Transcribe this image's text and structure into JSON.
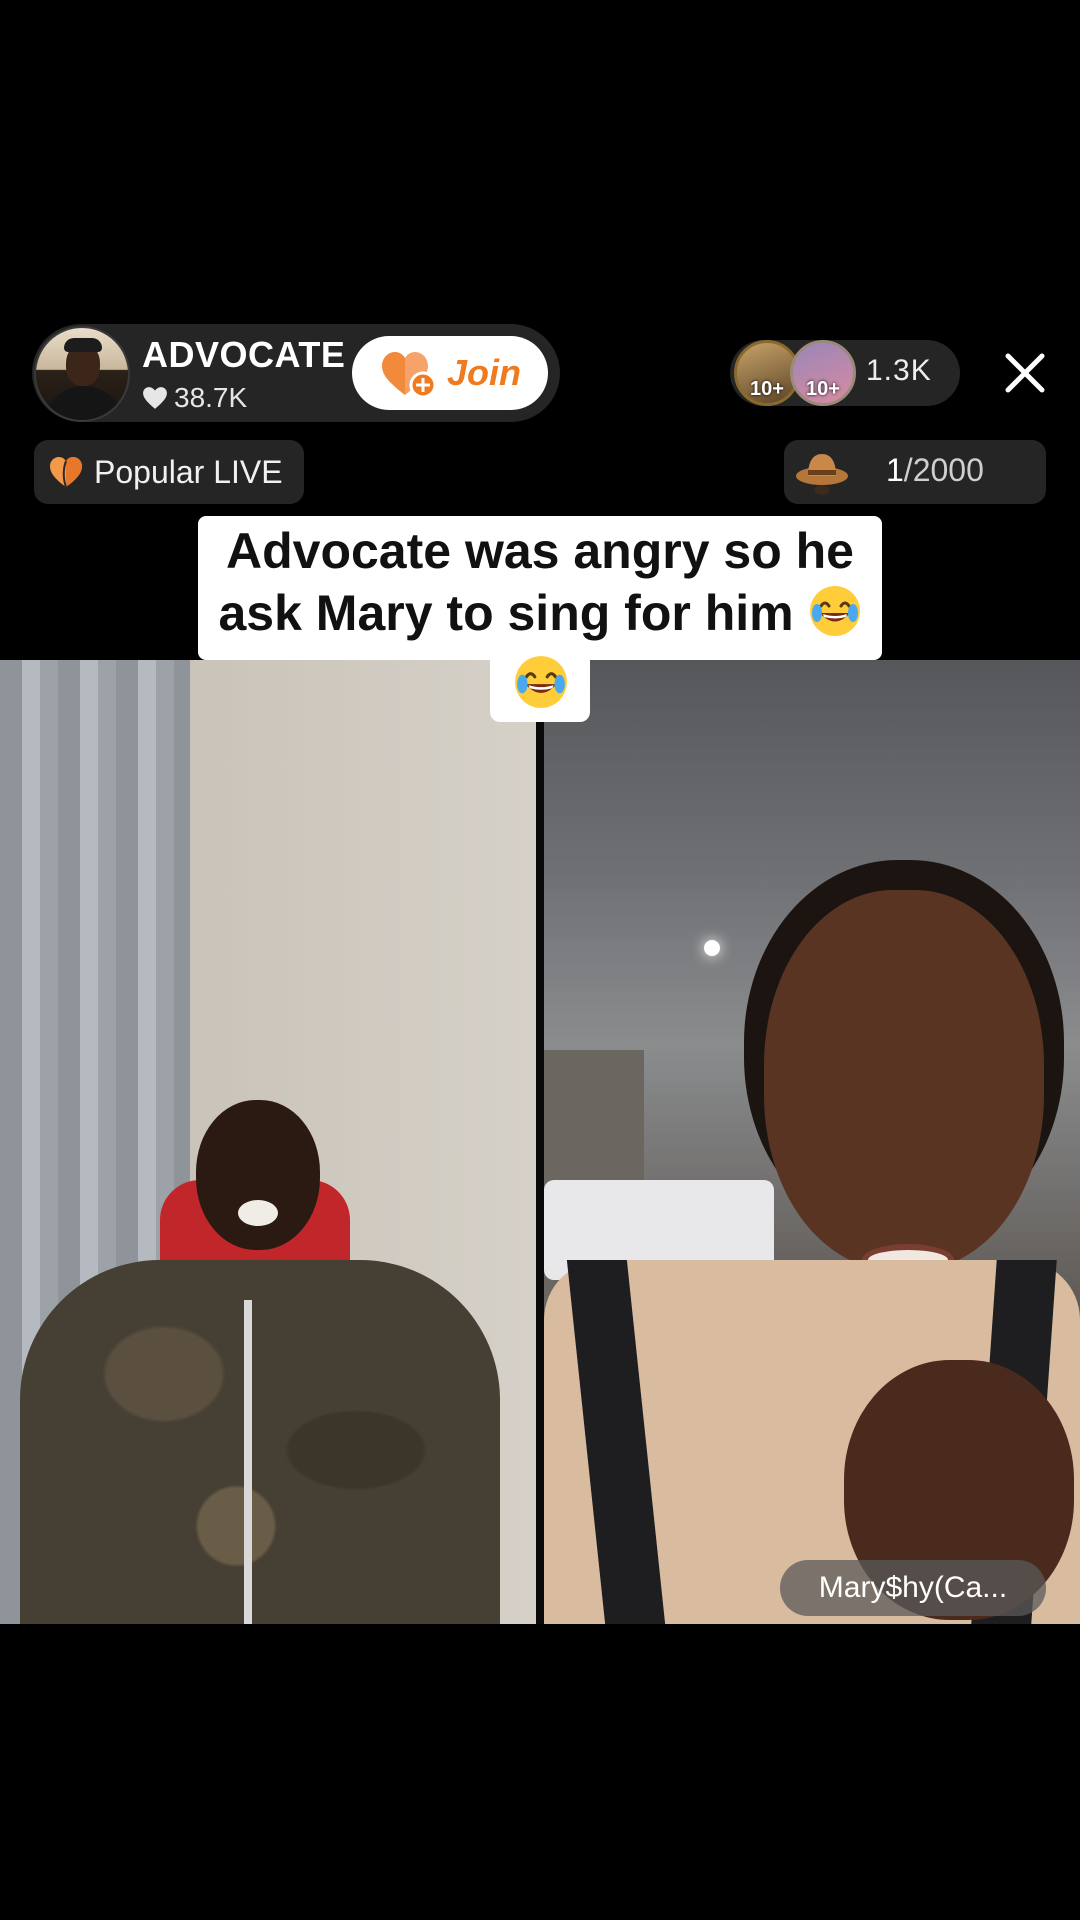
{
  "host": {
    "name": "ADVOCATE",
    "likes": "38.7K",
    "join_label": "Join",
    "icons": {
      "likes": "heart-icon",
      "join": "heart-plus-icon",
      "avatar": "avatar"
    }
  },
  "viewers": {
    "avatars": [
      {
        "badge": "10+"
      },
      {
        "badge": "10+"
      }
    ],
    "count": "1.3K"
  },
  "close": {
    "icon": "close-icon"
  },
  "popular": {
    "label": "Popular LIVE",
    "icon": "flame-heart-icon"
  },
  "goal": {
    "current": "1",
    "separator": "/",
    "max": "2000",
    "icon": "cowboy-hat-icon"
  },
  "caption": {
    "line1": "Advocate was angry so he",
    "line2": "ask Mary to sing for him",
    "emoji": "😂"
  },
  "guest": {
    "name": "Mary$hy(Ca..."
  },
  "colors": {
    "accent": "#f07a1e",
    "pill_bg": "#282828",
    "caption_bg": "#ffffff"
  }
}
